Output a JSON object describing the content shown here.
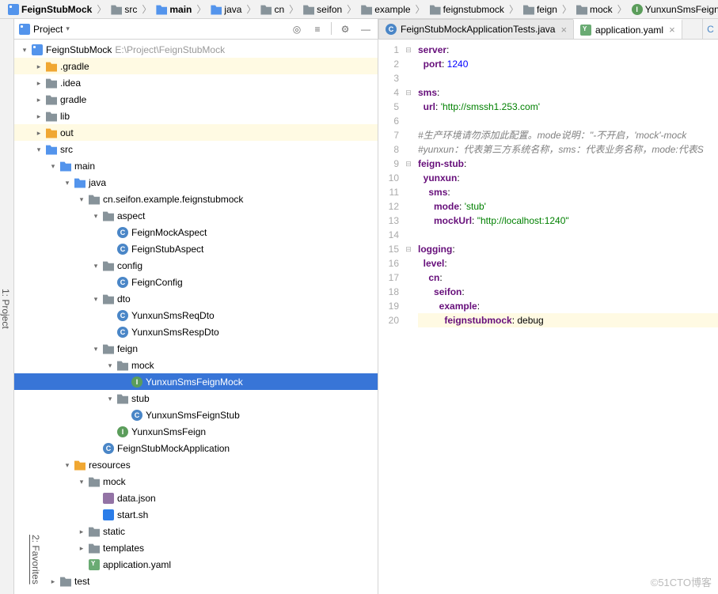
{
  "breadcrumb": [
    {
      "icon": "module",
      "label": "FeignStubMock",
      "bold": true
    },
    {
      "icon": "folder",
      "label": "src"
    },
    {
      "icon": "folder-blue",
      "label": "main",
      "bold": true
    },
    {
      "icon": "folder-blue",
      "label": "java"
    },
    {
      "icon": "folder",
      "label": "cn"
    },
    {
      "icon": "folder",
      "label": "seifon"
    },
    {
      "icon": "folder",
      "label": "example"
    },
    {
      "icon": "folder",
      "label": "feignstubmock"
    },
    {
      "icon": "folder",
      "label": "feign"
    },
    {
      "icon": "folder",
      "label": "mock"
    },
    {
      "icon": "interface",
      "label": "YunxunSmsFeignMock"
    }
  ],
  "panel": {
    "title": "Project"
  },
  "sidebar": {
    "project": "1: Project",
    "favorites": "2: Favorites"
  },
  "tree": [
    {
      "d": 0,
      "a": "down",
      "i": "module",
      "l": "FeignStubMock",
      "dim": "E:\\Project\\FeignStubMock"
    },
    {
      "d": 1,
      "a": "right",
      "i": "folder-orange",
      "l": ".gradle",
      "hl": true
    },
    {
      "d": 1,
      "a": "right",
      "i": "folder",
      "l": ".idea"
    },
    {
      "d": 1,
      "a": "right",
      "i": "folder",
      "l": "gradle"
    },
    {
      "d": 1,
      "a": "right",
      "i": "folder",
      "l": "lib"
    },
    {
      "d": 1,
      "a": "right",
      "i": "folder-orange",
      "l": "out",
      "hl": true
    },
    {
      "d": 1,
      "a": "down",
      "i": "folder-blue",
      "l": "src"
    },
    {
      "d": 2,
      "a": "down",
      "i": "folder-blue",
      "l": "main"
    },
    {
      "d": 3,
      "a": "down",
      "i": "folder-blue",
      "l": "java"
    },
    {
      "d": 4,
      "a": "down",
      "i": "folder",
      "l": "cn.seifon.example.feignstubmock"
    },
    {
      "d": 5,
      "a": "down",
      "i": "folder",
      "l": "aspect"
    },
    {
      "d": 6,
      "a": "",
      "i": "class",
      "l": "FeignMockAspect"
    },
    {
      "d": 6,
      "a": "",
      "i": "class",
      "l": "FeignStubAspect"
    },
    {
      "d": 5,
      "a": "down",
      "i": "folder",
      "l": "config"
    },
    {
      "d": 6,
      "a": "",
      "i": "class",
      "l": "FeignConfig"
    },
    {
      "d": 5,
      "a": "down",
      "i": "folder",
      "l": "dto"
    },
    {
      "d": 6,
      "a": "",
      "i": "class",
      "l": "YunxunSmsReqDto"
    },
    {
      "d": 6,
      "a": "",
      "i": "class",
      "l": "YunxunSmsRespDto"
    },
    {
      "d": 5,
      "a": "down",
      "i": "folder",
      "l": "feign"
    },
    {
      "d": 6,
      "a": "down",
      "i": "folder",
      "l": "mock"
    },
    {
      "d": 7,
      "a": "",
      "i": "interface",
      "l": "YunxunSmsFeignMock",
      "sel": true
    },
    {
      "d": 6,
      "a": "down",
      "i": "folder",
      "l": "stub"
    },
    {
      "d": 7,
      "a": "",
      "i": "class",
      "l": "YunxunSmsFeignStub"
    },
    {
      "d": 6,
      "a": "",
      "i": "interface",
      "l": "YunxunSmsFeign"
    },
    {
      "d": 5,
      "a": "",
      "i": "class",
      "l": "FeignStubMockApplication",
      "ex": "spring"
    },
    {
      "d": 3,
      "a": "down",
      "i": "folder-orange",
      "l": "resources"
    },
    {
      "d": 4,
      "a": "down",
      "i": "folder",
      "l": "mock"
    },
    {
      "d": 5,
      "a": "",
      "i": "json",
      "l": "data.json"
    },
    {
      "d": 5,
      "a": "",
      "i": "sh",
      "l": "start.sh"
    },
    {
      "d": 4,
      "a": "right",
      "i": "folder",
      "l": "static"
    },
    {
      "d": 4,
      "a": "right",
      "i": "folder",
      "l": "templates"
    },
    {
      "d": 4,
      "a": "",
      "i": "yaml",
      "l": "application.yaml"
    },
    {
      "d": 2,
      "a": "right",
      "i": "folder",
      "l": "test"
    }
  ],
  "tabs": [
    {
      "icon": "java",
      "label": "FeignStubMockApplicationTests.java",
      "active": false
    },
    {
      "icon": "yaml",
      "label": "application.yaml",
      "active": true
    }
  ],
  "code": [
    {
      "n": 1,
      "f": "-",
      "h": [
        [
          "key",
          "server"
        ],
        [
          "p",
          ":"
        ]
      ]
    },
    {
      "n": 2,
      "h": [
        [
          "p",
          "  "
        ],
        [
          "key",
          "port"
        ],
        [
          "p",
          ": "
        ],
        [
          "num",
          "1240"
        ]
      ]
    },
    {
      "n": 3,
      "h": []
    },
    {
      "n": 4,
      "f": "-",
      "h": [
        [
          "key",
          "sms"
        ],
        [
          "p",
          ":"
        ]
      ]
    },
    {
      "n": 5,
      "h": [
        [
          "p",
          "  "
        ],
        [
          "key",
          "url"
        ],
        [
          "p",
          ": "
        ],
        [
          "str",
          "'http://smssh1.253.com'"
        ]
      ]
    },
    {
      "n": 6,
      "h": []
    },
    {
      "n": 7,
      "h": [
        [
          "cmt",
          "#生产环境请勿添加此配置。mode说明：''-不开启，'mock'-mock"
        ]
      ]
    },
    {
      "n": 8,
      "h": [
        [
          "cmt",
          "#yunxun：代表第三方系统名称，sms：代表业务名称，mode:代表S"
        ]
      ]
    },
    {
      "n": 9,
      "f": "-",
      "h": [
        [
          "key",
          "feign-stub"
        ],
        [
          "p",
          ":"
        ]
      ]
    },
    {
      "n": 10,
      "h": [
        [
          "p",
          "  "
        ],
        [
          "key",
          "yunxun"
        ],
        [
          "p",
          ":"
        ]
      ]
    },
    {
      "n": 11,
      "h": [
        [
          "p",
          "    "
        ],
        [
          "key",
          "sms"
        ],
        [
          "p",
          ":"
        ]
      ]
    },
    {
      "n": 12,
      "h": [
        [
          "p",
          "      "
        ],
        [
          "key",
          "mode"
        ],
        [
          "p",
          ": "
        ],
        [
          "str",
          "'stub'"
        ]
      ]
    },
    {
      "n": 13,
      "h": [
        [
          "p",
          "      "
        ],
        [
          "key",
          "mockUrl"
        ],
        [
          "p",
          ": "
        ],
        [
          "str",
          "\"http://localhost:1240\""
        ]
      ]
    },
    {
      "n": 14,
      "h": []
    },
    {
      "n": 15,
      "f": "-",
      "h": [
        [
          "key",
          "logging"
        ],
        [
          "p",
          ":"
        ]
      ]
    },
    {
      "n": 16,
      "h": [
        [
          "p",
          "  "
        ],
        [
          "key",
          "level"
        ],
        [
          "p",
          ":"
        ]
      ]
    },
    {
      "n": 17,
      "h": [
        [
          "p",
          "    "
        ],
        [
          "key",
          "cn"
        ],
        [
          "p",
          ":"
        ]
      ]
    },
    {
      "n": 18,
      "h": [
        [
          "p",
          "      "
        ],
        [
          "key",
          "seifon"
        ],
        [
          "p",
          ":"
        ]
      ]
    },
    {
      "n": 19,
      "h": [
        [
          "p",
          "        "
        ],
        [
          "key",
          "example"
        ],
        [
          "p",
          ":"
        ]
      ]
    },
    {
      "n": 20,
      "hl": true,
      "h": [
        [
          "p",
          "          "
        ],
        [
          "key",
          "feignstubmock"
        ],
        [
          "p",
          ": debug"
        ]
      ]
    }
  ],
  "watermark": "©51CTO博客"
}
